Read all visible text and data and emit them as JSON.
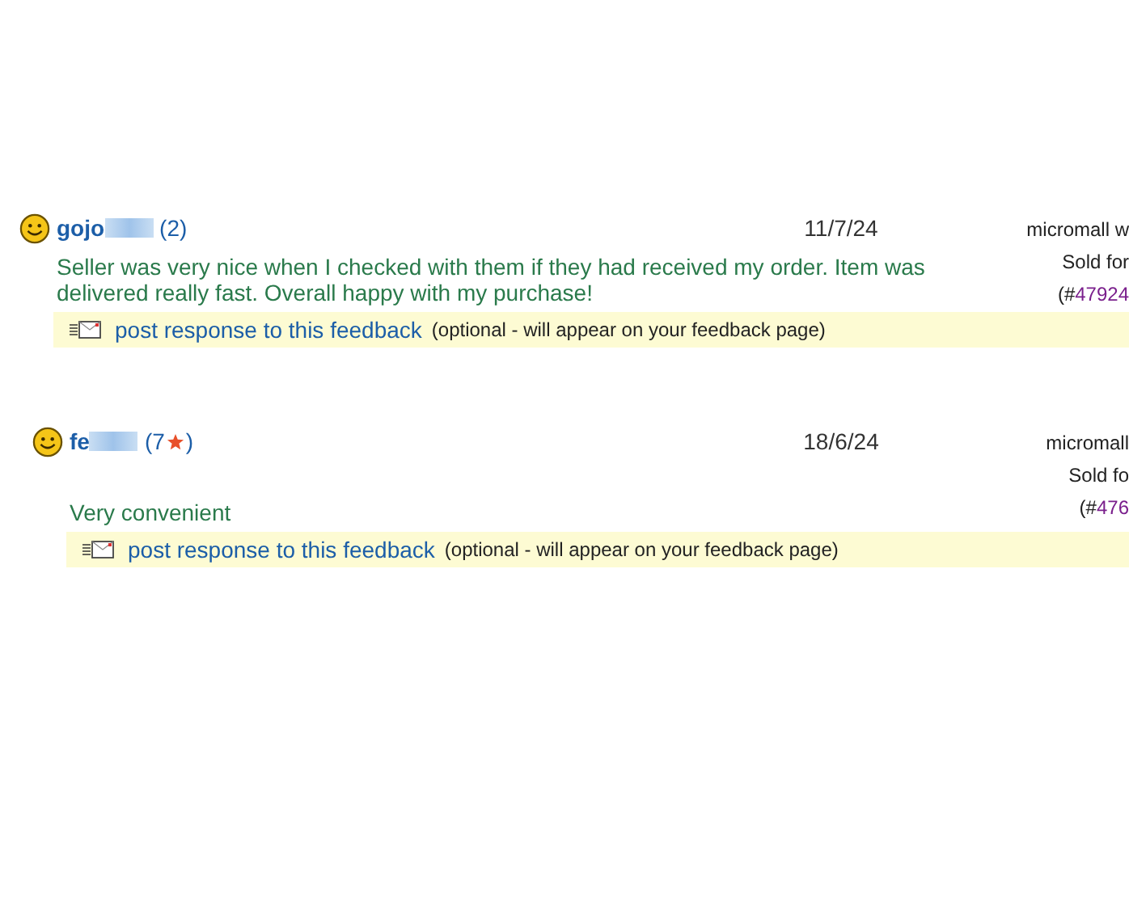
{
  "feedback": [
    {
      "user": {
        "name": "gojo",
        "redacted": true,
        "score": "(2 ",
        "star": false,
        "score_close": ")"
      },
      "date": "11/7/24",
      "comment": "Seller was very nice when I checked with them if they had received my order. Item was delivered really fast. Overall happy with my purchase!",
      "item": {
        "title": "micromall w",
        "price": "Sold for",
        "ref_open": "(#",
        "ref_number": "47924"
      },
      "response": {
        "link": "post response to this feedback",
        "note": "(optional - will appear on your feedback page)"
      }
    },
    {
      "user": {
        "name": "fe",
        "redacted": true,
        "score": "(7 ",
        "star": true,
        "score_close": ")"
      },
      "date": "18/6/24",
      "comment": "Very convenient",
      "item": {
        "title": "micromall",
        "price": "Sold fo",
        "ref_open": "(#",
        "ref_number": "476"
      },
      "response": {
        "link": "post response to this feedback",
        "note": "(optional - will appear on your feedback page)"
      }
    }
  ]
}
